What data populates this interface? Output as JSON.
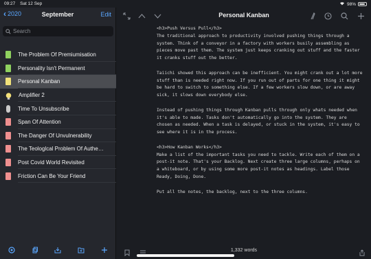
{
  "status": {
    "time": "09:27",
    "date": "Sat 12 Sep",
    "battery": "98%"
  },
  "sidebar": {
    "back_label": "2020",
    "title": "September",
    "edit_label": "Edit",
    "search_placeholder": "Search",
    "items": [
      {
        "label": "The Problem Of Premiumisation",
        "icon": "green-note-icon",
        "color": "#8fd15f"
      },
      {
        "label": "Personality Isn't Permanent",
        "icon": "green-note-icon",
        "color": "#8fd15f"
      },
      {
        "label": "Personal Kanban",
        "icon": "yellow-note-icon",
        "color": "#f2e27a",
        "selected": true
      },
      {
        "label": "Amplifier 2",
        "icon": "lightbulb-icon",
        "color": "#f4e07a"
      },
      {
        "label": "Time To Unsubscribe",
        "icon": "microphone-icon",
        "color": "#c9c9c9"
      },
      {
        "label": "Span Of Attention",
        "icon": "red-note-icon",
        "color": "#ef8f8f"
      },
      {
        "label": "The Danger Of Unvulnerability",
        "icon": "red-note-icon",
        "color": "#ef8f8f"
      },
      {
        "label": "The Teologlcal Problem Of Authentic...",
        "icon": "red-note-icon",
        "color": "#ef8f8f"
      },
      {
        "label": "Post Covid World Revisited",
        "icon": "red-note-icon",
        "color": "#ef8f8f"
      },
      {
        "label": "Friction Can Be Your Friend",
        "icon": "red-note-icon",
        "color": "#ef8f8f"
      }
    ]
  },
  "document": {
    "title": "Personal Kanban",
    "paragraphs": [
      "<h3>Push Versus Pull</h3>\nThe traditional approach to productivity involved pushing things through a system. Think of a conveyor in a factory with workers busily assembling as pieces move past them. The system just keeps cranking out stuff and the faster it cranks stuff out the better.",
      "Taiichi showed this approach can be inefficient. You might crank out a lot more stuff than is needed right now. If you run out of parts for one thing it might be hard to switch to something else. If a few workers slow down, or are away sick, it slows down everybody else.",
      "Instead of pushing things through Kanban pulls through only whats needed when it's able to made. Tasks don't automatically go into the system. They are chosen as needed. When a task is delayed, or stuck in the system, it's easy to see where it is in the process.",
      "<h3>How Kanban Works</h3>\nMake a list of the important tasks you need to tackle.  Write each of them on a post-it note. That's your Backlog. Next create three large columns, perhaps on a whiteboard, or by using some more post-it notes as headings. Label those Ready, Doing, Done.",
      "Put all the notes, the backlog, next to the three columns."
    ],
    "word_count": "1,332 words"
  },
  "colors": {
    "accent": "#5aa7ff",
    "sidebar_bg": "#25272d",
    "editor_bg": "#1b1d22",
    "selected_bg": "#4b4d52"
  }
}
